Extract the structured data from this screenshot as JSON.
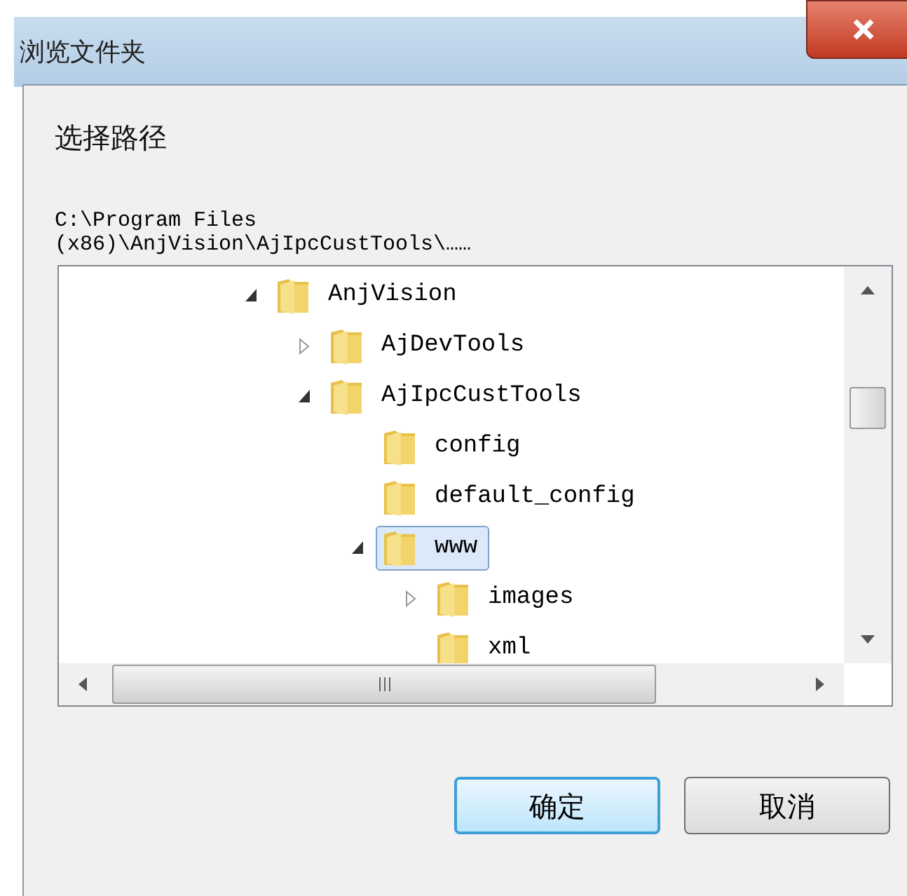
{
  "window": {
    "title": "浏览文件夹"
  },
  "heading": "选择路径",
  "path_lines": [
    "C:\\Program Files",
    "(x86)\\AnjVision\\AjIpcCustTools\\……"
  ],
  "tree": [
    {
      "label": "AnjVision",
      "expanded": true,
      "selected": false,
      "children": [
        {
          "label": "AjDevTools",
          "expanded": false,
          "selected": false
        },
        {
          "label": "AjIpcCustTools",
          "expanded": true,
          "selected": false,
          "children": [
            {
              "label": "config",
              "selected": false
            },
            {
              "label": "default_config",
              "selected": false
            },
            {
              "label": "www",
              "expanded": true,
              "selected": true,
              "children": [
                {
                  "label": "images",
                  "expanded": false,
                  "selected": false
                },
                {
                  "label": "xml",
                  "selected": false
                }
              ]
            }
          ]
        }
      ]
    }
  ],
  "buttons": [
    {
      "label": "确定",
      "kind": "default"
    },
    {
      "label": "取消",
      "kind": "normal"
    }
  ]
}
